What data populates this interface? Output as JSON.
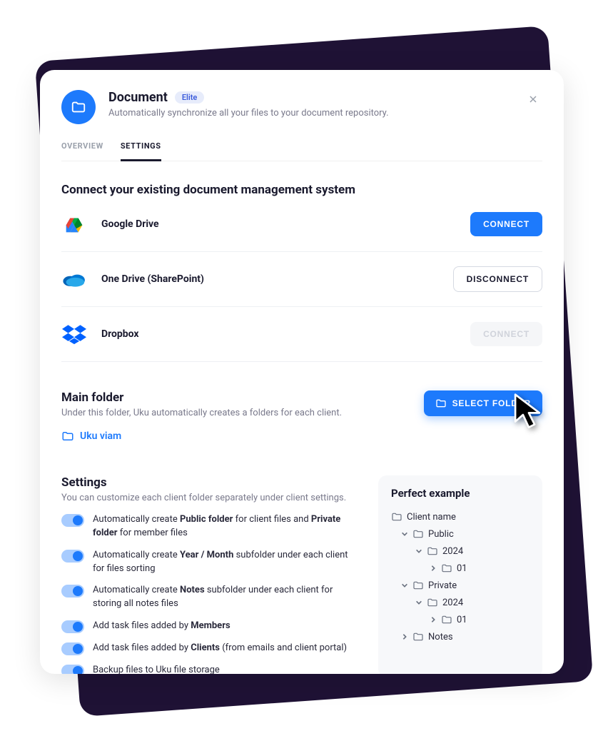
{
  "header": {
    "title": "Document",
    "badge": "Elite",
    "subtitle": "Automatically synchronize all your files to your document repository."
  },
  "tabs": {
    "overview": "OVERVIEW",
    "settings": "SETTINGS"
  },
  "connect": {
    "title": "Connect your existing document management system",
    "providers": [
      {
        "name": "Google Drive",
        "button": "CONNECT",
        "state": "primary"
      },
      {
        "name": "One Drive (SharePoint)",
        "button": "DISCONNECT",
        "state": "outline"
      },
      {
        "name": "Dropbox",
        "button": "CONNECT",
        "state": "ghost"
      }
    ]
  },
  "mainfolder": {
    "title": "Main folder",
    "subtitle": "Under this folder, Uku automatically creates a folders for each client.",
    "current": "Uku viam",
    "button": "SELECT FOLDER"
  },
  "settings": {
    "title": "Settings",
    "subtitle": "You can customize each client folder separately under client settings.",
    "items": [
      {
        "html": "Automatically create <b>Public folder</b> for client files and <b>Private folder</b> for member files",
        "on": true
      },
      {
        "html": "Automatically create <b>Year / Month</b> subfolder under each client for files sorting",
        "on": true
      },
      {
        "html": "Automatically create <b>Notes</b> subfolder under each client for storing all notes files",
        "on": true
      },
      {
        "html": "Add task files added by <b>Members</b>",
        "on": true
      },
      {
        "html": "Add task files added by <b>Clients</b> (from emails and client portal)",
        "on": true
      },
      {
        "html": "Backup files to Uku file storage",
        "on": true
      }
    ]
  },
  "example": {
    "title": "Perfect example",
    "tree": {
      "client": "Client name",
      "public": "Public",
      "year_public": "2024",
      "month_public": "01",
      "private": "Private",
      "year_private": "2024",
      "month_private": "01",
      "notes": "Notes"
    }
  }
}
